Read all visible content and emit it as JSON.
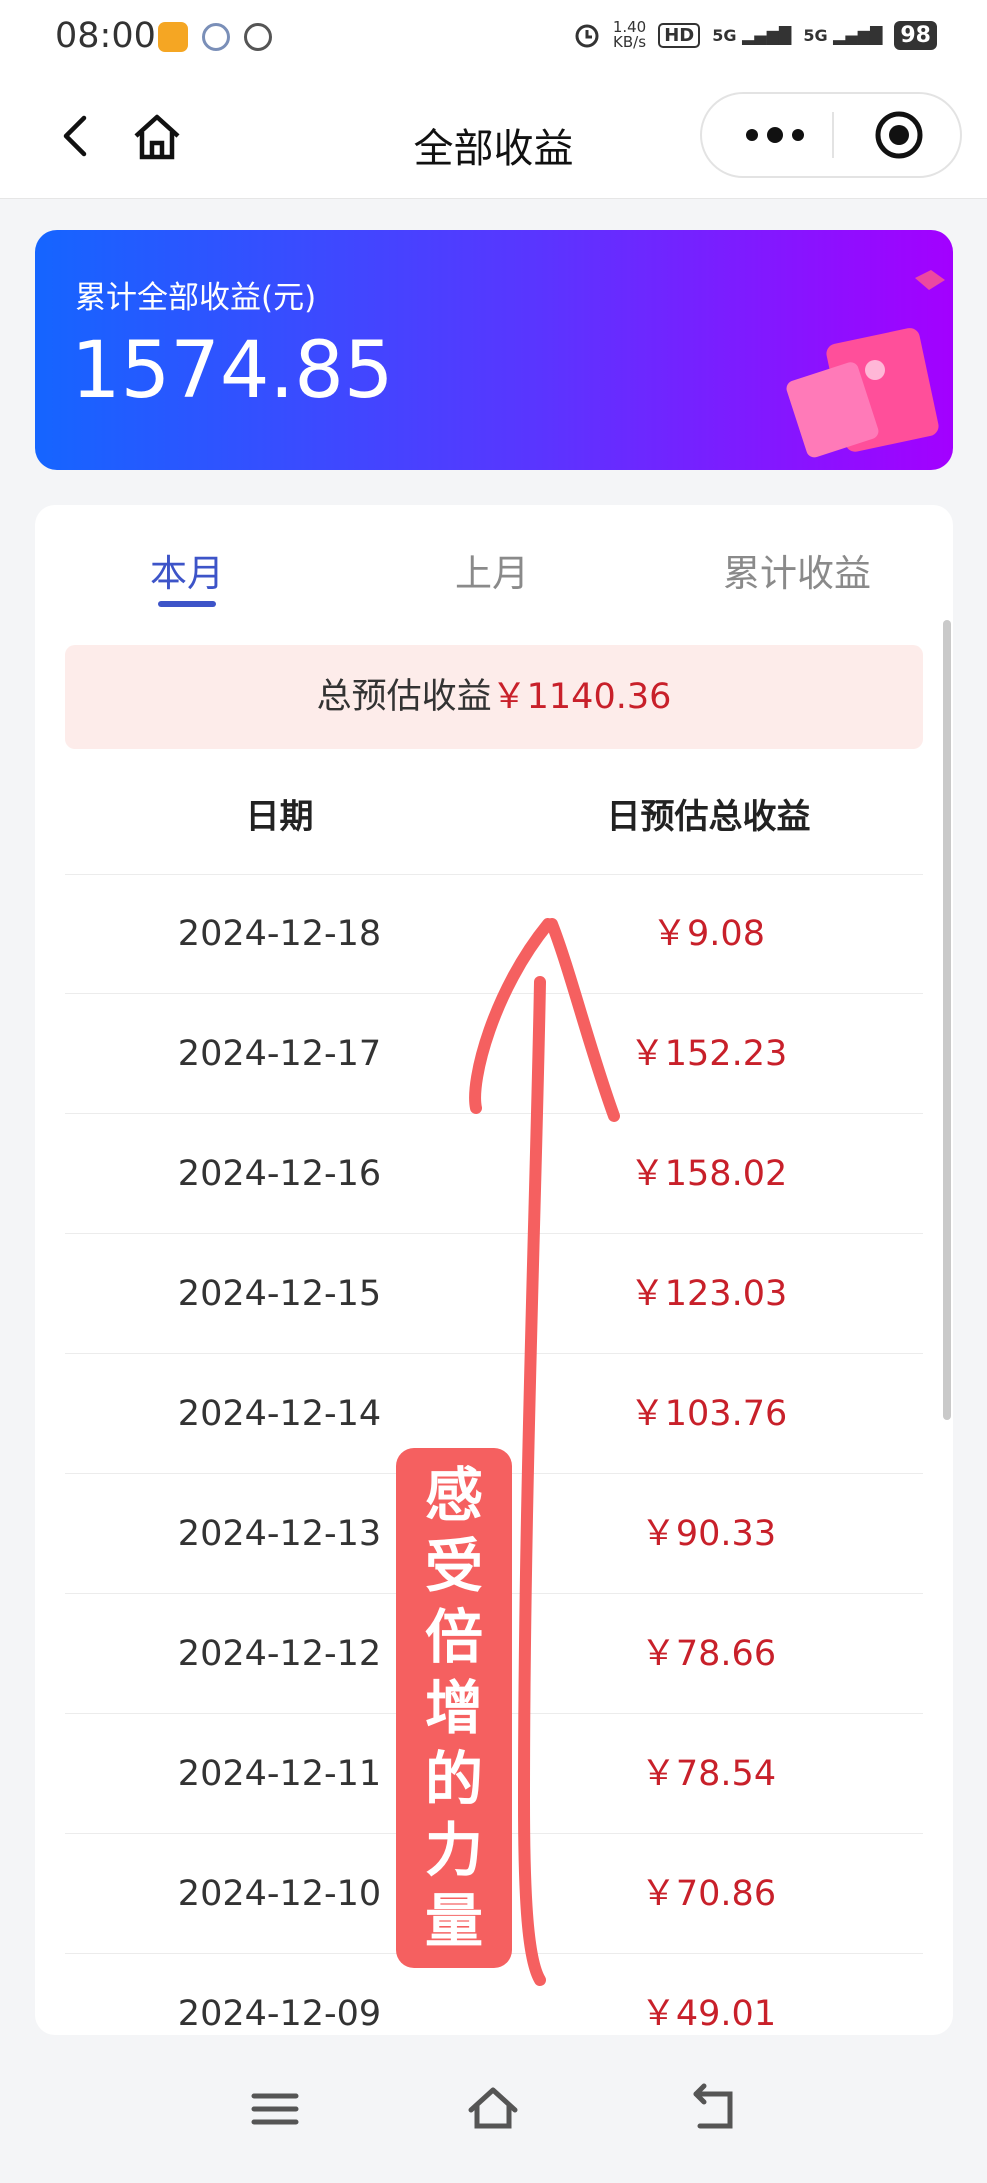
{
  "status_bar": {
    "time": "08:00",
    "net_speed_value": "1.40",
    "net_speed_unit": "KB/s",
    "hd": "HD",
    "signal_1": "5G",
    "signal_2": "5G",
    "battery": "98"
  },
  "nav": {
    "title": "全部收益",
    "icons": [
      "back-icon",
      "home-icon",
      "more-icon",
      "close-target-icon"
    ]
  },
  "banner": {
    "label": "累计全部收益(元)",
    "value": "1574.85"
  },
  "tabs": [
    {
      "label": "本月",
      "active": true
    },
    {
      "label": "上月",
      "active": false
    },
    {
      "label": "累计收益",
      "active": false
    }
  ],
  "summary": {
    "label": "总预估收益",
    "amount": "￥1140.36"
  },
  "table": {
    "headers": [
      "日期",
      "日预估总收益"
    ],
    "rows": [
      {
        "date": "2024-12-18",
        "amount": "￥9.08"
      },
      {
        "date": "2024-12-17",
        "amount": "￥152.23"
      },
      {
        "date": "2024-12-16",
        "amount": "￥158.02"
      },
      {
        "date": "2024-12-15",
        "amount": "￥123.03"
      },
      {
        "date": "2024-12-14",
        "amount": "￥103.76"
      },
      {
        "date": "2024-12-13",
        "amount": "￥90.33"
      },
      {
        "date": "2024-12-12",
        "amount": "￥78.66"
      },
      {
        "date": "2024-12-11",
        "amount": "￥78.54"
      },
      {
        "date": "2024-12-10",
        "amount": "￥70.86"
      },
      {
        "date": "2024-12-09",
        "amount": "￥49.01"
      }
    ]
  },
  "annotation": {
    "chars": [
      "感",
      "受",
      "倍",
      "增",
      "的",
      "力",
      "量"
    ],
    "color": "#f56060"
  },
  "colors": {
    "accent": "#3d54c8",
    "money": "#c8202a"
  }
}
